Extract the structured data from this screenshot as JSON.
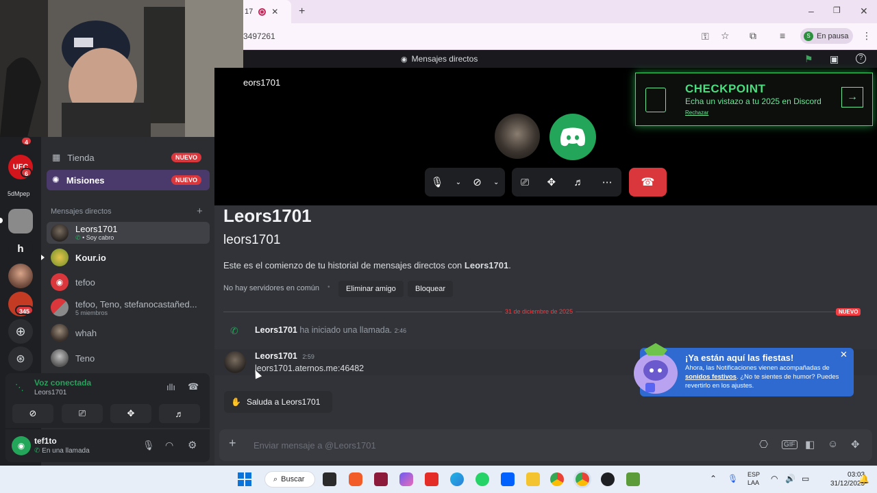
{
  "browser": {
    "url": "3497261",
    "profile_label": "En pausa",
    "profile_initial": "S"
  },
  "discord": {
    "top_title": "Mensajes directos",
    "call": {
      "name": "eors1701"
    },
    "checkpoint": {
      "title": "CHECKPOINT",
      "subtitle": "Echa un vistazo a tu 2025 en Discord",
      "dismiss": "Rechazar"
    },
    "servers": [
      {
        "label": "UFC",
        "badge": "6",
        "color": "#d4151b"
      },
      {
        "label": "5dMpep",
        "badge": "",
        "color": "#1e1f22"
      },
      {
        "label": "h",
        "badge": "",
        "color": "#1e1f22"
      },
      {
        "label": "",
        "badge": "345",
        "color": "#c23b22"
      }
    ],
    "top_server_badge": "4",
    "sidebar": {
      "shop_label": "Tienda",
      "missions_label": "Misiones",
      "new_badge": "NUEVO",
      "dm_header": "Mensajes directos",
      "dms": [
        {
          "name": "Leors1701",
          "sub": "• Soy cabro",
          "active": true
        },
        {
          "name": "Kour.io",
          "sub": ""
        },
        {
          "name": "tefoo",
          "sub": ""
        },
        {
          "name": "tefoo, Teno, stefanocastañed...",
          "sub": "5 miembros"
        },
        {
          "name": "whah",
          "sub": ""
        },
        {
          "name": "Teno",
          "sub": ""
        }
      ]
    },
    "voice": {
      "status": "Voz conectada",
      "channel": "Leors1701"
    },
    "user": {
      "name": "tef1to",
      "status": "En una llamada"
    },
    "chat": {
      "title": "Leors1701",
      "username": "leors1701",
      "intro_prefix": "Este es el comienzo de tu historial de mensajes directos con ",
      "intro_name": "Leors1701",
      "intro_suffix": ".",
      "no_common": "No hay servidores en común",
      "remove_friend": "Eliminar amigo",
      "block": "Bloquear",
      "divider_date": "31 de diciembre de 2025",
      "divider_new": "NUEVO",
      "call_msg": {
        "author": "Leors1701",
        "text": " ha iniciado una llamada.",
        "time": "2:46"
      },
      "msg": {
        "author": "Leors1701",
        "time": "2:59",
        "text": "leors1701.aternos.me:46482"
      },
      "wave_label": "Saluda a Leors1701",
      "composer_placeholder": "Enviar mensaje a @Leors1701"
    },
    "toast": {
      "title": "¡Ya están aquí las fiestas!",
      "body_prefix": "Ahora, las Notificaciones vienen acompañadas de ",
      "body_link": "sonidos festivos",
      "body_suffix": ". ¿No te sientes de humor? Puedes revertirlo en los ajustes."
    }
  },
  "taskbar": {
    "search": "Buscar",
    "lang1": "ESP",
    "lang2": "LAA",
    "time": "03:03",
    "date": "31/12/2025"
  }
}
